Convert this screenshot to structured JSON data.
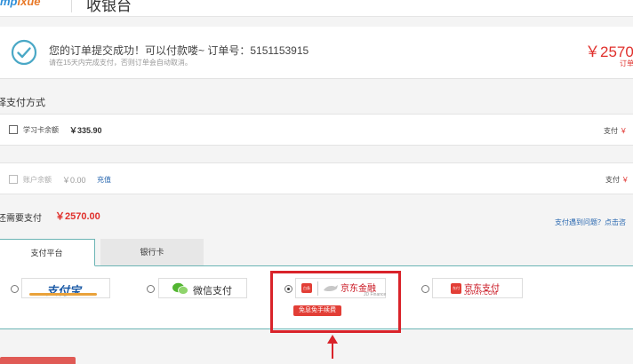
{
  "header": {
    "logo_text": "mp",
    "logo_text_2": "ixue",
    "title": "收银台"
  },
  "order": {
    "success_message": "您的订单提交成功！可以付款喽~ 订单号：5151153915",
    "notice": "请在15天内完成支付，否则订单会自动取消。",
    "amount": "￥2570.",
    "amount_label": "订单"
  },
  "payment": {
    "section_title": "择支付方式",
    "study_card": {
      "label": "学习卡余额",
      "value": "￥335.90",
      "pay_label": "支付",
      "pay_value": "￥"
    },
    "account": {
      "label": "账户余额",
      "value": "￥0.00",
      "recharge": "充值",
      "pay_label": "支付",
      "pay_value": "￥"
    },
    "need_label": "还需要支付",
    "need_amount": "￥2570.00",
    "help_link": "支付遇到问题？点击咨"
  },
  "tabs": [
    {
      "label": "支付平台",
      "active": true
    },
    {
      "label": "银行卡",
      "active": false
    }
  ],
  "methods": {
    "alipay": "支付宝",
    "wechat": "微信支付",
    "jd_finance": {
      "name": "京东金融",
      "sub": "JD Finance",
      "tag": "白条",
      "badge": "免息免手续费"
    },
    "jd_pay": {
      "name": "京东支付",
      "sub": "JDPAY.COM",
      "tag": "东付"
    }
  },
  "colors": {
    "accent_red": "#e0302c",
    "highlight_red": "#d9232a",
    "tab_border": "#6bb4b4",
    "link_blue": "#2a68b0"
  }
}
